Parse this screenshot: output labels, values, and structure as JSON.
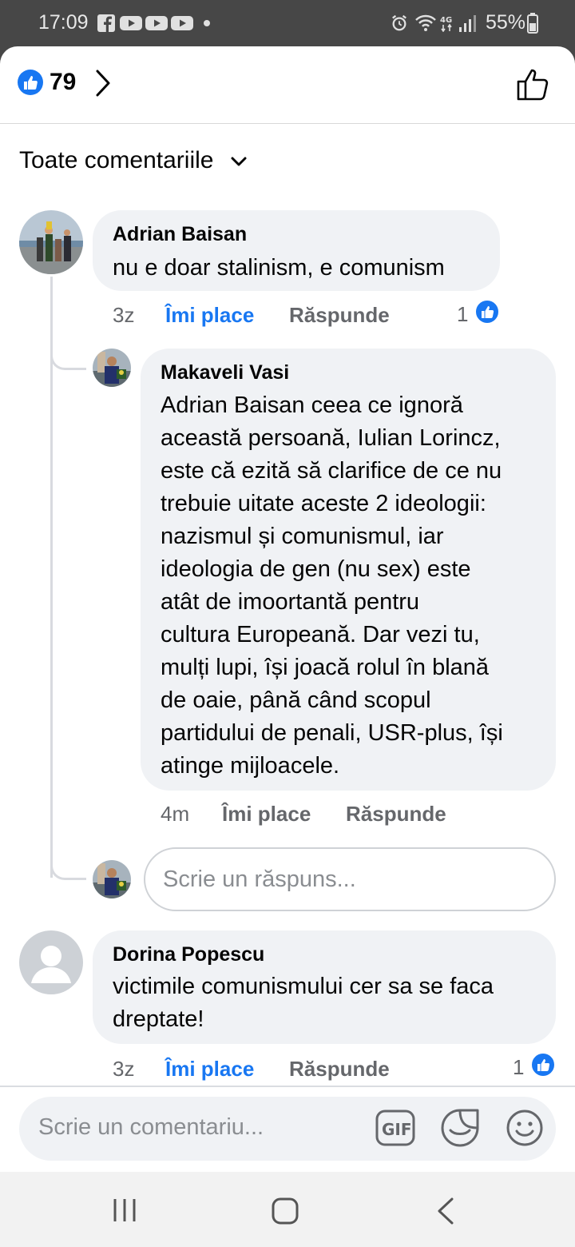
{
  "status_bar": {
    "time": "17:09",
    "battery": "55%",
    "icons": [
      "facebook-icon",
      "youtube-icon",
      "youtube-icon",
      "youtube-icon",
      "dot-icon",
      "alarm-icon",
      "wifi-icon",
      "4g-icon",
      "signal-icon",
      "battery-icon"
    ]
  },
  "header": {
    "like_count": "79",
    "icons": [
      "like-reaction-icon",
      "chevron-right-icon",
      "thumbs-up-icon"
    ]
  },
  "filter": {
    "label": "Toate comentariile"
  },
  "comments": [
    {
      "author": "Adrian Baisan",
      "text": "nu e doar stalinism, e comunism",
      "time": "3z",
      "like_label": "Îmi place",
      "reply_label": "Răspunde",
      "reactions": "1",
      "liked": true
    },
    {
      "author": "Makaveli Vasi",
      "text_lines": [
        "Adrian Baisan ceea ce ignoră",
        "această persoană, Iulian Lorincz,",
        "este că ezită să clarifice de ce nu",
        "trebuie uitate aceste 2 ideologii:",
        "nazismul și comunismul, iar",
        "ideologia de gen (nu sex) este",
        "atât de imoortantă pentru",
        "cultura Europeană. Dar vezi tu,",
        "mulți lupi, își joacă rolul în blană",
        "de oaie, până când scopul",
        "partidului de penali, USR-plus, își",
        "atinge mijloacele."
      ],
      "time": "4m",
      "like_label": "Îmi place",
      "reply_label": "Răspunde"
    },
    {
      "author": "Dorina Popescu",
      "text_lines": [
        "victimile comunismului cer sa se faca",
        "dreptate!"
      ],
      "time": "3z",
      "like_label": "Îmi place",
      "reply_label": "Răspunde",
      "reactions": "1",
      "liked": true
    }
  ],
  "reply_input": {
    "placeholder": "Scrie un răspuns..."
  },
  "comment_input": {
    "placeholder": "Scrie un comentariu...",
    "icons": [
      "gif-icon",
      "sticker-icon",
      "emoji-icon"
    ]
  },
  "nav_bar": {
    "icons": [
      "recent-apps-icon",
      "home-icon",
      "back-icon"
    ]
  },
  "colors": {
    "accent": "#1877f2",
    "bubble": "#f0f2f5",
    "muted": "#65676b",
    "status_bar": "#474747"
  }
}
